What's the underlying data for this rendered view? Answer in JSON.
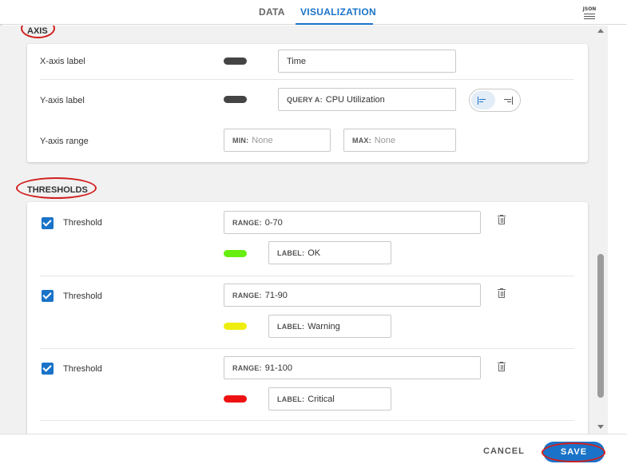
{
  "tabs": [
    {
      "label": "DATA",
      "active": false
    },
    {
      "label": "VISUALIZATION",
      "active": true
    }
  ],
  "json_icon": {
    "text": "JSON",
    "name": "json-icon"
  },
  "axis": {
    "heading": "AXIS",
    "x_label": {
      "label": "X-axis label",
      "value": "Time",
      "swatch_color": "#444444"
    },
    "y_label": {
      "label": "Y-axis label",
      "prefix": "QUERY A:",
      "value": "CPU Utilization",
      "swatch_color": "#444444",
      "alignment": "left"
    },
    "y_range": {
      "label": "Y-axis range",
      "min_prefix": "MIN:",
      "min_placeholder": "None",
      "max_prefix": "MAX:",
      "max_placeholder": "None"
    }
  },
  "thresholds": {
    "heading": "THRESHOLDS",
    "items": [
      {
        "checked": true,
        "label": "Threshold",
        "range_prefix": "RANGE:",
        "range": "0-70",
        "label_prefix": "LABEL:",
        "label_value": "OK",
        "color": "#66ee11"
      },
      {
        "checked": true,
        "label": "Threshold",
        "range_prefix": "RANGE:",
        "range": "71-90",
        "label_prefix": "LABEL:",
        "label_value": "Warning",
        "color": "#eeee11"
      },
      {
        "checked": true,
        "label": "Threshold",
        "range_prefix": "RANGE:",
        "range": "91-100",
        "label_prefix": "LABEL:",
        "label_value": "Critical",
        "color": "#ee1111"
      }
    ]
  },
  "footer": {
    "cancel": "CANCEL",
    "save": "SAVE"
  },
  "colors": {
    "accent": "#1a73c8",
    "annotation": "#d21f1f"
  }
}
